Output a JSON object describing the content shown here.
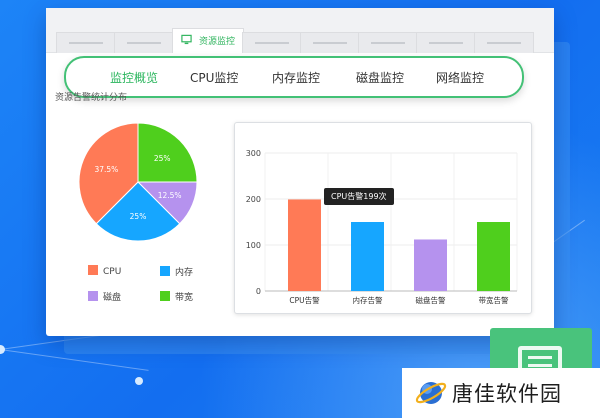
{
  "window": {
    "active_tab_label": "资源监控",
    "top_tab_count_visual": 8
  },
  "nav": {
    "items": [
      {
        "label": "监控概览",
        "active": true
      },
      {
        "label": "CPU监控",
        "active": false
      },
      {
        "label": "内存监控",
        "active": false
      },
      {
        "label": "磁盘监控",
        "active": false
      },
      {
        "label": "网络监控",
        "active": false
      }
    ]
  },
  "section": {
    "title": "资源告警统计分布"
  },
  "tooltip": {
    "text": "CPU告警199次"
  },
  "watermark": {
    "text": "唐佳软件园"
  },
  "colors": {
    "accent": "#29b55c",
    "cpu": "#ff7a56",
    "memory": "#16a6ff",
    "disk": "#b592ee",
    "bandwidth": "#4fcf1d"
  },
  "chart_data": [
    {
      "type": "pie",
      "slices": [
        {
          "label": "CPU",
          "value": 37.5,
          "display": "37.5%",
          "color": "#ff7a56"
        },
        {
          "label": "内存",
          "value": 25,
          "display": "25%",
          "color": "#16a6ff"
        },
        {
          "label": "磁盘",
          "value": 12.5,
          "display": "12.5%",
          "color": "#b592ee"
        },
        {
          "label": "带宽",
          "value": 25,
          "display": "25%",
          "color": "#4fcf1d"
        }
      ],
      "legend": [
        {
          "label": "CPU",
          "color": "#ff7a56"
        },
        {
          "label": "内存",
          "color": "#16a6ff"
        },
        {
          "label": "磁盘",
          "color": "#b592ee"
        },
        {
          "label": "带宽",
          "color": "#4fcf1d"
        }
      ]
    },
    {
      "type": "bar",
      "categories": [
        "CPU告警",
        "内存告警",
        "磁盘告警",
        "带宽告警"
      ],
      "values": [
        199,
        150,
        112,
        150
      ],
      "colors": [
        "#ff7a56",
        "#16a6ff",
        "#b592ee",
        "#4fcf1d"
      ],
      "yticks": [
        0,
        100,
        200,
        300
      ],
      "ylim": [
        0,
        300
      ],
      "grid": true
    }
  ]
}
